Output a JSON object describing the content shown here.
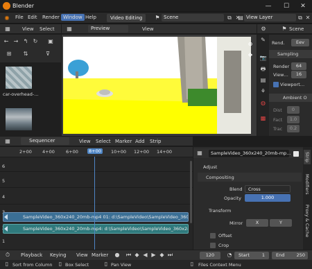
{
  "window": {
    "title": "Blender",
    "min": "—",
    "max": "☐",
    "close": "✕"
  },
  "topbar": {
    "menus": [
      "File",
      "Edit",
      "Render",
      "Window",
      "Help"
    ],
    "workspace": "Video Editing",
    "scene": "Scene",
    "view_layer": "View Layer"
  },
  "file_browser": {
    "view": "View",
    "select": "Select",
    "file1": "car-overhead-…",
    "file2": ""
  },
  "preview": {
    "mode": "Preview",
    "view": "View"
  },
  "properties": {
    "scene_label": "Scene",
    "render_engine": "Rend.",
    "engine_value": "Eev",
    "sampling_label": "Sampling",
    "render_label": "Render",
    "render_value": "64",
    "viewport_label": "View…",
    "viewport_value": "16",
    "viewport_denoise": "Viewport…",
    "ao_label": "Ambient O",
    "dist_label": "Dist",
    "dist_value": "0",
    "fact_label": "Fact",
    "fact_value": "1.0",
    "trac_label": "Trac",
    "trac_value": "0.2"
  },
  "sequencer": {
    "mode": "Sequencer",
    "menus": [
      "View",
      "Select",
      "Marker",
      "Add",
      "Strip"
    ],
    "frames": [
      "2+00",
      "4+00",
      "6+00",
      "8+00",
      "10+00",
      "12+00",
      "14+00"
    ],
    "current_frame": "8+00",
    "channels": [
      "6",
      "5",
      "4",
      "3",
      "2",
      "1"
    ],
    "strip1_label": "SampleVideo_360x240_20mb-mp4 01: d:\\SampleVideo\\SampleVideo_360x240_20mb.mp4",
    "strip2_label": "SampleVideo_360x240_20mb-mp4: d:\\SampleVideo\\SampleVideo_360x240_20mb.mp4"
  },
  "strip_panel": {
    "strip_name": "SampleVideo_360x240_20mb-mp…",
    "adjust": "Adjust",
    "compositing": "Compositing",
    "blend_label": "Blend",
    "blend_value": "Cross",
    "opacity_label": "Opacity",
    "opacity_value": "1.000",
    "transform": "Transform",
    "mirror_label": "Mirror",
    "mirror_x": "X",
    "mirror_y": "Y",
    "offset": "Offset",
    "crop": "Crop",
    "tabs": [
      "Strip",
      "Modifiers",
      "Proxy & Cache"
    ]
  },
  "timeline": {
    "playback": "Playback",
    "keying": "Keying",
    "view": "View",
    "marker": "Marker",
    "frame": "120",
    "start_label": "Start",
    "start_value": "1",
    "end_label": "End",
    "end_value": "250"
  },
  "statusbar": {
    "item1": "Sort from Column",
    "item2": "Box Select",
    "item3": "Pan View",
    "item4": "Files Context Menu"
  },
  "colors": {
    "accent": "#4772b3",
    "strip": "#3b6f95",
    "strip_sound": "#2f7a7d",
    "playhead": "#4f86c6",
    "header": "#303030"
  }
}
